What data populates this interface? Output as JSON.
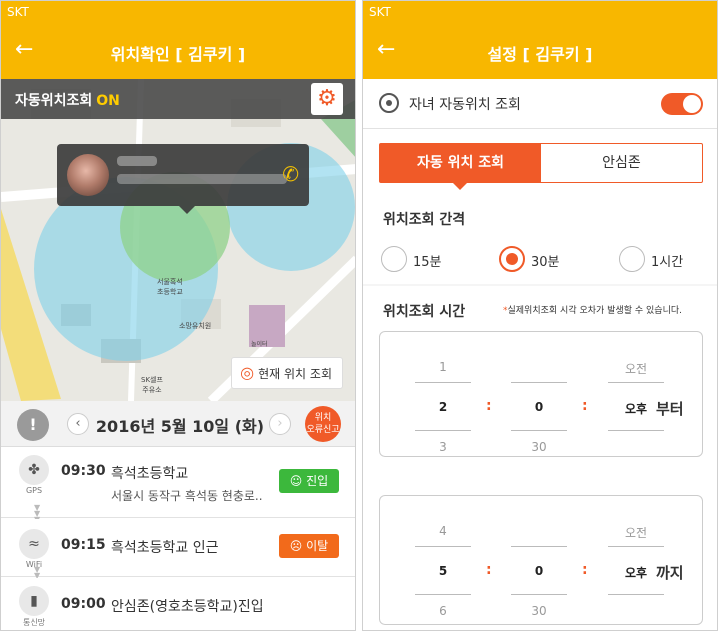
{
  "left": {
    "status_carrier": "SKT",
    "title": "위치확인 [ 김쿠키 ]",
    "auto": {
      "label": "자동위치조회",
      "state": "ON"
    },
    "map_labels": {
      "school": "서울흑석\n초등학교",
      "kinder": "소망유치원",
      "gas": "SK셀프\n주유소",
      "parking": "놀이터"
    },
    "current_location_btn": "현재 위치 조회",
    "date": "2016년 5월 10일 (화)",
    "report_btn": "위치\n오류신고",
    "entries": [
      {
        "icon": "gps-icon",
        "icon_caption": "GPS",
        "time": "09:30",
        "place": "흑석초등학교",
        "address": "서울시 동작구 흑석동 현충로...",
        "badge": "진입",
        "badge_type": "in"
      },
      {
        "icon": "wifi-icon",
        "icon_caption": "WiFi",
        "time": "09:15",
        "place": "흑석초등학교 인근",
        "address": "",
        "badge": "이탈",
        "badge_type": "out"
      },
      {
        "icon": "network-icon",
        "icon_caption": "통신망",
        "time": "09:00",
        "place": "안심존(영호초등학교)진입",
        "address": "",
        "badge": "",
        "badge_type": ""
      }
    ]
  },
  "right": {
    "status_carrier": "SKT",
    "title": "설정 [ 김쿠키 ]",
    "toggle_label": "자녀 자동위치 조회",
    "tabs": {
      "active": "자동 위치 조회",
      "inactive": "안심존"
    },
    "interval": {
      "title": "위치조회 간격",
      "options": [
        "15분",
        "30분",
        "1시간"
      ],
      "selected": 1
    },
    "time_section": {
      "title": "위치조회 시간",
      "note": "실제위치조회 시각 오차가 발생할 수 있습니다."
    },
    "from_picker": {
      "hour": [
        "1",
        "2",
        "3"
      ],
      "minute": [
        "",
        "0",
        "30"
      ],
      "ampm": [
        "오전",
        "오후",
        ""
      ],
      "suffix": "부터"
    },
    "to_picker": {
      "hour": [
        "4",
        "5",
        "6"
      ],
      "minute": [
        "",
        "0",
        "30"
      ],
      "ampm": [
        "오전",
        "오후",
        ""
      ],
      "suffix": "까지"
    }
  },
  "colors": {
    "brand": "#f8b700",
    "accent": "#f05a28",
    "in": "#3cb83c",
    "out": "#f26a1b"
  }
}
